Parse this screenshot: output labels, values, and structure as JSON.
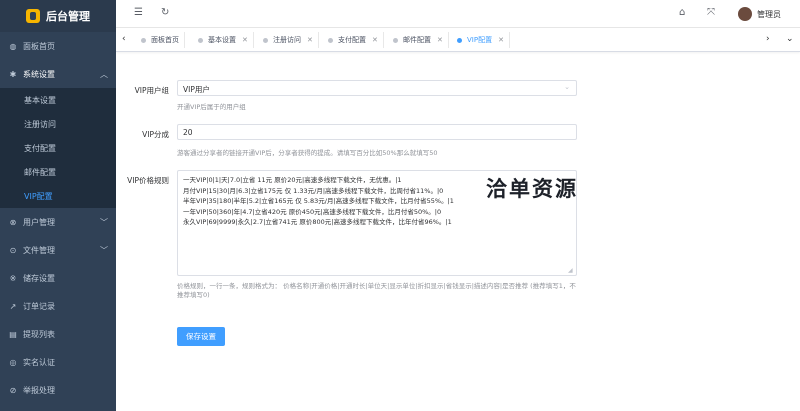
{
  "app": {
    "title": "后台管理"
  },
  "sidebar": {
    "items": [
      {
        "label": "面板首页",
        "icon": "dashboard-icon",
        "glyph": "◍"
      },
      {
        "label": "系统设置",
        "icon": "gear-icon",
        "glyph": "✱"
      },
      {
        "label": "用户管理",
        "icon": "user-icon",
        "glyph": "⊗"
      },
      {
        "label": "文件管理",
        "icon": "folder-icon",
        "glyph": "⊙"
      },
      {
        "label": "储存设置",
        "icon": "storage-icon",
        "glyph": "※"
      },
      {
        "label": "订单记录",
        "icon": "order-icon",
        "glyph": "↗"
      },
      {
        "label": "提现列表",
        "icon": "withdraw-icon",
        "glyph": "▤"
      },
      {
        "label": "实名认证",
        "icon": "verify-icon",
        "glyph": "◎"
      },
      {
        "label": "举报处理",
        "icon": "report-icon",
        "glyph": "⊘"
      }
    ],
    "submenu": [
      "基本设置",
      "注册访问",
      "支付配置",
      "邮件配置",
      "VIP配置"
    ]
  },
  "navbar": {
    "user": "管理员"
  },
  "tags": [
    "面板首页",
    "基本设置",
    "注册访问",
    "支付配置",
    "邮件配置",
    "VIP配置"
  ],
  "form": {
    "vip_group_label": "VIP用户组",
    "vip_group_value": "VIP用户",
    "vip_group_hint": "开通VIP后属于的用户组",
    "vip_share_label": "VIP分成",
    "vip_share_value": "20",
    "vip_share_hint": "游客通过分享者的链接开通VIP后，分享者获得的提成。请填写百分比如50%那么就填写50",
    "vip_price_label": "VIP价格规则",
    "vip_price_value": "一天VIP|0|1|天|7.0|立省 11元 原价20元|高速多线程下载文件，无优惠。|1\n月付VIP|15|30|月|6.3|立省175元 仅 1.33元/月|高速多线程下载文件，比周付省11%。|0\n半年VIP|35|180|半年|5.2|立省165元 仅 5.83元/月|高速多线程下载文件，比月付省55%。|1\n一年VIP|50|360|年|4.7|立省420元 原价450元|高速多线程下载文件，比月付省50%。|0\n永久VIP|69|9999|永久|2.7|立省741元 原价800元|高速多线程下载文件，比年付省96%。|1",
    "vip_price_hint": "价格规则，一行一条，规则格式为：  价格名称|开通价格|开通时长|单位天|显示单位|折扣显示|省钱显示|描述内容|是否推荐 (推荐填写1，不推荐填写0)",
    "save_label": "保存设置"
  },
  "watermark": "洽单资源",
  "colors": {
    "sidebar": "#304156",
    "accent": "#409eff",
    "logo": "#f7b500"
  }
}
